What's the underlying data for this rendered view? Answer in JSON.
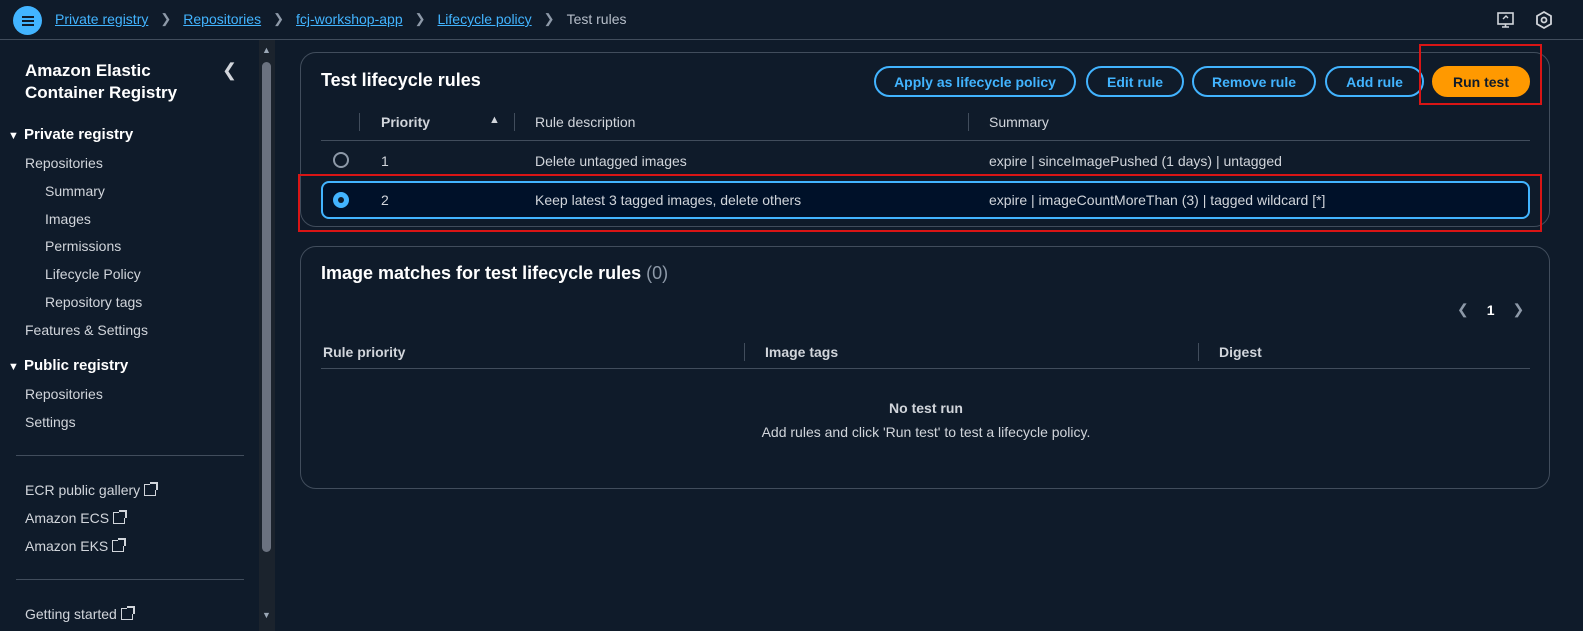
{
  "breadcrumb": [
    "Private registry",
    "Repositories",
    "fcj-workshop-app",
    "Lifecycle policy"
  ],
  "breadcrumb_current": "Test rules",
  "sidebar": {
    "title": "Amazon Elastic Container Registry",
    "private_section": "Private registry",
    "private_items": {
      "repositories": "Repositories",
      "summary": "Summary",
      "images": "Images",
      "permissions": "Permissions",
      "lifecycle": "Lifecycle Policy",
      "repo_tags": "Repository tags",
      "features": "Features & Settings"
    },
    "public_section": "Public registry",
    "public_items": {
      "repositories": "Repositories",
      "settings": "Settings"
    },
    "links": {
      "gallery": "ECR public gallery",
      "ecs": "Amazon ECS",
      "eks": "Amazon EKS",
      "getting_started": "Getting started"
    }
  },
  "rules_panel": {
    "title": "Test lifecycle rules",
    "buttons": {
      "apply": "Apply as lifecycle policy",
      "edit": "Edit rule",
      "remove": "Remove rule",
      "add": "Add rule",
      "run": "Run test"
    },
    "columns": {
      "priority": "Priority",
      "description": "Rule description",
      "summary": "Summary"
    },
    "rows": [
      {
        "priority": "1",
        "description": "Delete untagged images",
        "summary": "expire | sinceImagePushed (1 days) | untagged",
        "selected": false
      },
      {
        "priority": "2",
        "description": "Keep latest 3 tagged images, delete others",
        "summary": "expire | imageCountMoreThan (3) | tagged wildcard [*]",
        "selected": true
      }
    ]
  },
  "matches_panel": {
    "title": "Image matches for test lifecycle rules",
    "count": "(0)",
    "page": "1",
    "columns": {
      "priority": "Rule priority",
      "tags": "Image tags",
      "digest": "Digest"
    },
    "empty_title": "No test run",
    "empty_text": "Add rules and click 'Run test' to test a lifecycle policy."
  },
  "colors": {
    "background": "#0f1b2a",
    "accent": "#42b4ff",
    "primary_button": "#ff9900",
    "highlight": "#d91515"
  }
}
